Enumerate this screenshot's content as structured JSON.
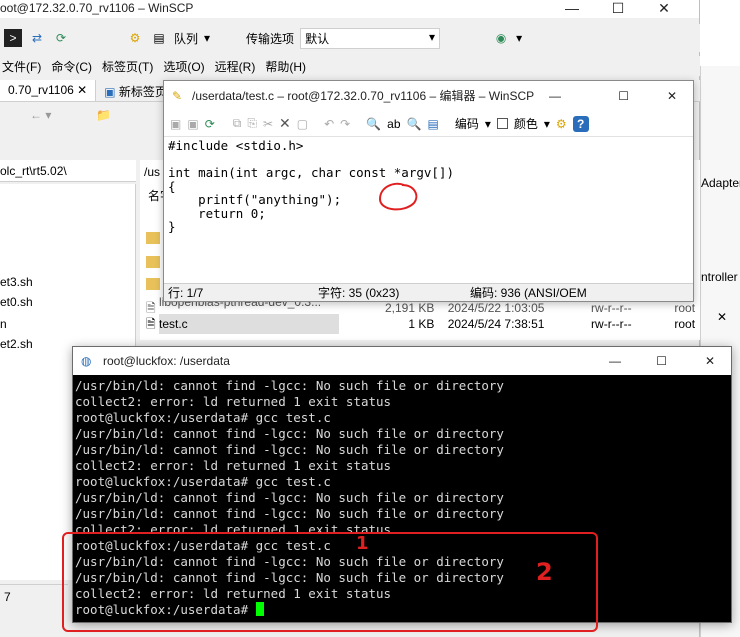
{
  "winscp": {
    "title": "oot@172.32.0.70_rv1106 – WinSCP",
    "toolbar": {
      "queue_label": "队列",
      "transfer_label": "传输选项",
      "transfer_value": "默认"
    },
    "menu": [
      "文件(F)",
      "命令(C)",
      "标签页(T)",
      "选项(O)",
      "远程(R)",
      "帮助(H)"
    ],
    "tabs": [
      "0.70_rv1106",
      "新标签页"
    ],
    "left_path": "olc_rt\\rt5.02\\",
    "left_files": [
      "et3.sh",
      "et0.sh",
      "n",
      "et2.sh"
    ],
    "left_bottom": "7",
    "right_path": "/us",
    "right_header": "名字",
    "right_files": [
      {
        "name": "libopenblas-pthread-dev_0.3...",
        "size": "2,191 KB",
        "date": "2024/5/22 1:03:05",
        "perm": "rw-r--r--",
        "owner": "root"
      },
      {
        "name": "test.c",
        "size": "1 KB",
        "date": "2024/5/24 7:38:51",
        "perm": "rw-r--r--",
        "owner": "root"
      }
    ],
    "side_right_1": "Adapter",
    "side_right_2": "ntroller"
  },
  "editor": {
    "title": "/userdata/test.c – root@172.32.0.70_rv1106 – 编辑器 – WinSCP",
    "encoding_label": "编码",
    "color_label": "颜色",
    "code_lines": [
      "#include <stdio.h>",
      "",
      "int main(int argc, char const *argv[])",
      "{",
      "    printf(\"anything\");",
      "    return 0;",
      "}"
    ],
    "status": {
      "line": "行: 1/7",
      "chars": "字符: 35 (0x23)",
      "encoding": "编码: 936  (ANSI/OEM"
    }
  },
  "terminal": {
    "title": "root@luckfox: /userdata",
    "lines": [
      "/usr/bin/ld: cannot find -lgcc: No such file or directory",
      "collect2: error: ld returned 1 exit status",
      "root@luckfox:/userdata# gcc test.c",
      "/usr/bin/ld: cannot find -lgcc: No such file or directory",
      "/usr/bin/ld: cannot find -lgcc: No such file or directory",
      "collect2: error: ld returned 1 exit status",
      "root@luckfox:/userdata# gcc test.c",
      "/usr/bin/ld: cannot find -lgcc: No such file or directory",
      "/usr/bin/ld: cannot find -lgcc: No such file or directory",
      "collect2: error: ld returned 1 exit status",
      "root@luckfox:/userdata# gcc test.c",
      "/usr/bin/ld: cannot find -lgcc: No such file or directory",
      "/usr/bin/ld: cannot find -lgcc: No such file or directory",
      "collect2: error: ld returned 1 exit status"
    ],
    "prompt": "root@luckfox:/userdata# "
  },
  "annotations": {
    "mark1": "1",
    "mark2": "2"
  },
  "colors": {
    "terminal_bg": "#000000",
    "cursor": "#00ff00",
    "annotation": "#e02020",
    "winscp_chrome": "#f0f0f0"
  }
}
